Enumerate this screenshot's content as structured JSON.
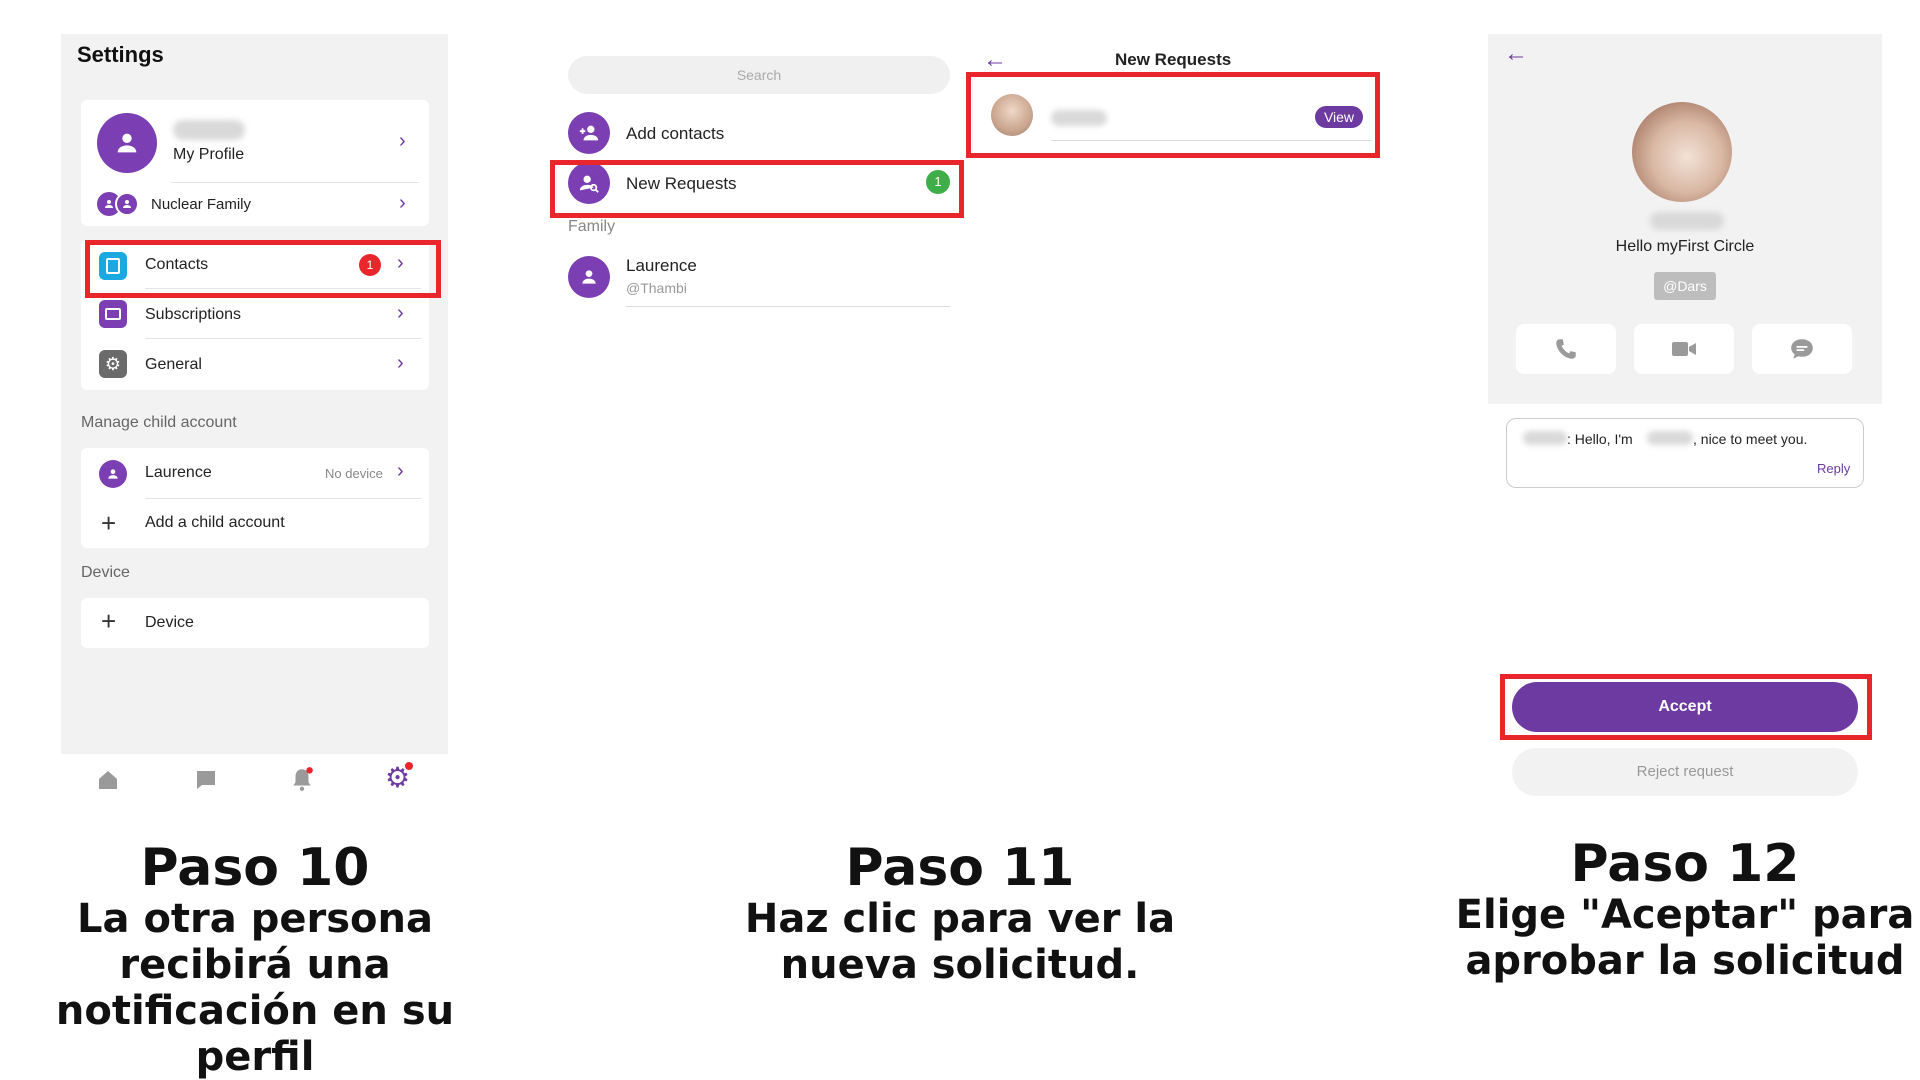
{
  "panel1": {
    "title": "Settings",
    "profile_label": "My Profile",
    "family_label": "Nuclear Family",
    "menu": [
      {
        "label": "Contacts",
        "badge": "1"
      },
      {
        "label": "Subscriptions"
      },
      {
        "label": "General"
      }
    ],
    "manage_header": "Manage child account",
    "child_name": "Laurence",
    "child_status": "No device",
    "add_child_label": "Add a child account",
    "device_header": "Device",
    "device_label": "Device"
  },
  "panel2": {
    "search_placeholder": "Search",
    "add_contacts_label": "Add contacts",
    "new_requests_label": "New Requests",
    "new_requests_badge": "1",
    "family_header": "Family",
    "contact_name": "Laurence",
    "contact_handle": "@Thambi",
    "requests_title": "New Requests",
    "view_label": "View"
  },
  "panel3": {
    "status": "Hello myFirst Circle",
    "handle": "@Dars",
    "message_mid": ": Hello, I'm",
    "message_end": ", nice to meet you.",
    "reply_label": "Reply",
    "accept_label": "Accept",
    "reject_label": "Reject request"
  },
  "captions": [
    {
      "num": "Paso 10",
      "lines": [
        "La otra persona",
        "recibirá una",
        "notificación en su",
        "perfil"
      ]
    },
    {
      "num": "Paso 11",
      "lines": [
        "Haz clic para ver la",
        "nueva solicitud."
      ]
    },
    {
      "num": "Paso 12",
      "lines": [
        "Elige \"Aceptar\" para",
        "aprobar la solicitud"
      ]
    }
  ],
  "colors": {
    "accent": "#6c3aa0",
    "highlight": "#e8262c",
    "badge_red": "#e8262c",
    "badge_green": "#3fae49",
    "panel_bg": "#f2f2f2"
  }
}
